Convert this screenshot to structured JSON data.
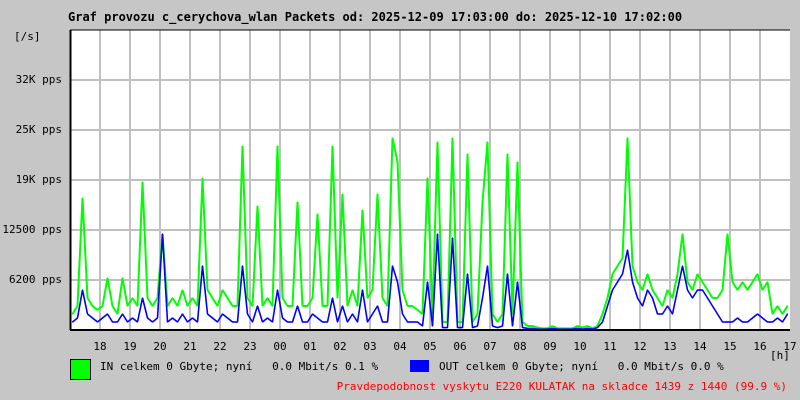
{
  "chart_data": {
    "type": "line",
    "title": "Graf provozu c_cerychova_wlan Packets od: 2025-12-09 17:03:00 do: 2025-12-10 17:02:00",
    "ylabel": "[/s]",
    "xlabel": "[h]",
    "ylim": [
      0,
      37500
    ],
    "y_ticks": [
      {
        "value": 6250,
        "label": "6200 pps"
      },
      {
        "value": 12500,
        "label": "12500 pps"
      },
      {
        "value": 18750,
        "label": "19K pps"
      },
      {
        "value": 25000,
        "label": "25K pps"
      },
      {
        "value": 31250,
        "label": "32K pps"
      }
    ],
    "x_ticks": [
      "18",
      "19",
      "20",
      "21",
      "22",
      "23",
      "00",
      "01",
      "02",
      "03",
      "04",
      "05",
      "06",
      "07",
      "08",
      "09",
      "10",
      "11",
      "12",
      "13",
      "14",
      "15",
      "16",
      "17"
    ],
    "x_start": "17:00",
    "sample_minutes": 10,
    "grid": true,
    "series": [
      {
        "name": "IN",
        "color": "#00ff00",
        "unit": "kpps",
        "values": [
          2,
          3,
          16.5,
          4,
          3,
          2.5,
          3,
          6.5,
          3,
          2,
          6.5,
          3,
          4,
          3,
          18.5,
          4,
          3,
          4,
          12,
          3,
          4,
          3,
          5,
          3,
          4,
          3,
          19,
          5,
          4,
          3,
          5,
          4,
          3,
          3,
          23,
          4,
          3,
          15.5,
          3,
          4,
          3,
          23,
          4,
          3,
          3,
          16,
          3,
          3,
          4,
          14.5,
          3,
          3,
          23,
          4,
          17,
          3,
          5,
          3,
          15,
          4,
          5,
          17,
          4,
          3,
          24,
          21,
          5,
          3,
          3,
          2.5,
          2,
          19,
          2,
          23.5,
          1,
          1,
          24,
          1,
          1,
          22,
          1,
          2,
          16,
          23.5,
          2,
          1,
          2,
          22,
          2,
          21,
          1,
          0.5,
          0.5,
          0.3,
          0.2,
          0.2,
          0.5,
          0.2,
          0.2,
          0.2,
          0.2,
          0.5,
          0.3,
          0.5,
          0.2,
          0.5,
          2,
          4,
          7,
          8,
          9,
          24,
          8,
          6,
          5,
          7,
          5,
          4,
          3,
          5,
          4,
          7,
          12,
          6,
          5,
          7,
          6,
          5,
          4,
          4,
          5,
          12,
          6,
          5,
          6,
          5,
          6,
          7,
          5,
          6,
          2,
          3,
          2,
          3
        ]
      },
      {
        "name": "OUT",
        "color": "#0000ff",
        "unit": "kpps",
        "values": [
          1,
          1.5,
          5,
          2,
          1.5,
          1,
          1.5,
          2,
          1,
          1,
          2,
          1,
          1.5,
          1,
          4,
          1.5,
          1,
          1.5,
          12,
          1,
          1.5,
          1,
          2,
          1,
          1.5,
          1,
          8,
          2,
          1.5,
          1,
          2,
          1.5,
          1,
          1,
          8,
          2,
          1,
          3,
          1,
          1.5,
          1,
          5,
          1.5,
          1,
          1,
          3,
          1,
          1,
          2,
          1.5,
          1,
          1,
          4,
          1,
          3,
          1,
          2,
          1,
          5,
          1,
          2,
          3,
          1,
          1,
          8,
          6,
          2,
          1,
          1,
          1,
          0.5,
          6,
          0.5,
          12,
          0.3,
          0.3,
          11.5,
          0.3,
          0.3,
          7,
          0.3,
          0.5,
          4,
          8,
          0.5,
          0.3,
          0.5,
          7,
          0.5,
          6,
          0.3,
          0.2,
          0.2,
          0.1,
          0.1,
          0.1,
          0.2,
          0.1,
          0.1,
          0.1,
          0.1,
          0.2,
          0.1,
          0.2,
          0.1,
          0.3,
          1,
          3,
          5,
          6,
          7,
          10,
          6,
          4,
          3,
          5,
          4,
          2,
          2,
          3,
          2,
          5,
          8,
          5,
          4,
          5,
          5,
          4,
          3,
          2,
          1,
          1,
          1,
          1.5,
          1,
          1,
          1.5,
          2,
          1.5,
          1,
          1,
          1.5,
          1,
          2
        ]
      }
    ]
  },
  "legend": {
    "in_label": "IN celkem 0 Gbyte; nyní   0.0 Mbit/s 0.1 %",
    "out_label": "OUT celkem 0 Gbyte; nyní   0.0 Mbit/s 0.0 %",
    "in_color": "#00ff00",
    "out_color": "#0000ff"
  },
  "note": "Pravdepodobnost vyskytu E220 KULATAK na skladce 1439 z 1440 (99.9 %)",
  "note_color": "#ff0000"
}
